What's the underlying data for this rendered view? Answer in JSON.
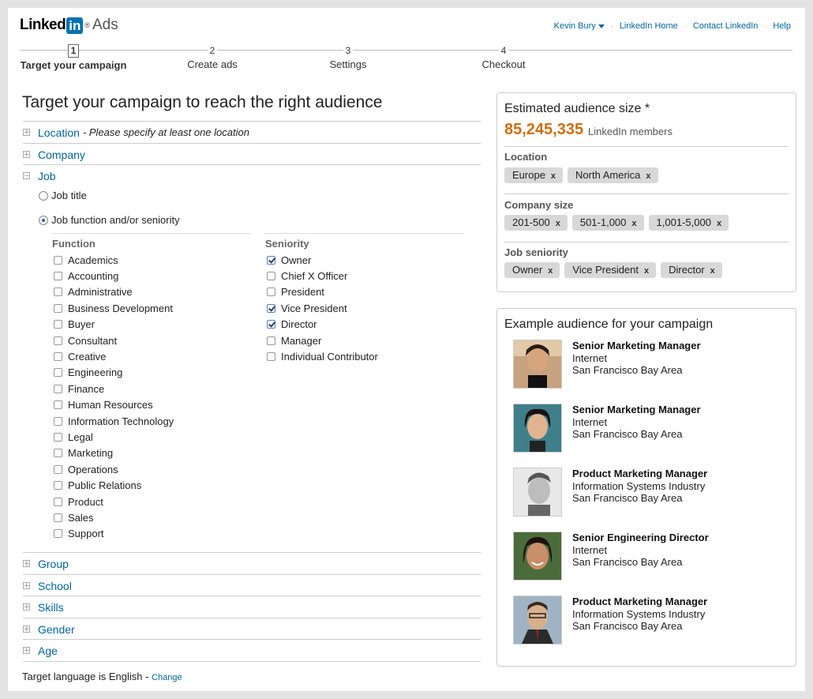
{
  "header": {
    "logo_linked": "Linked",
    "logo_in": "in",
    "logo_reg": "®",
    "logo_ads": "Ads",
    "links": [
      {
        "label": "Kevin Bury",
        "dropdown": true
      },
      {
        "label": "LinkedIn Home"
      },
      {
        "label": "Contact LinkedIn"
      },
      {
        "label": "Help"
      }
    ],
    "separator": "·"
  },
  "steps": [
    {
      "num": "1",
      "label": "Target your campaign",
      "active": true
    },
    {
      "num": "2",
      "label": "Create ads",
      "active": false
    },
    {
      "num": "3",
      "label": "Settings",
      "active": false
    },
    {
      "num": "4",
      "label": "Checkout",
      "active": false
    }
  ],
  "targeting": {
    "title": "Target your campaign to reach the right audience",
    "location": {
      "label": "Location",
      "note": "- Please specify at least one location"
    },
    "company": {
      "label": "Company"
    },
    "job": {
      "label": "Job",
      "radio_title": "Job title",
      "radio_function": "Job function and/or seniority",
      "selected": "function"
    },
    "function_header": "Function",
    "functions": [
      {
        "label": "Academics",
        "checked": false
      },
      {
        "label": "Accounting",
        "checked": false
      },
      {
        "label": "Administrative",
        "checked": false
      },
      {
        "label": "Business Development",
        "checked": false
      },
      {
        "label": "Buyer",
        "checked": false
      },
      {
        "label": "Consultant",
        "checked": false
      },
      {
        "label": "Creative",
        "checked": false
      },
      {
        "label": "Engineering",
        "checked": false
      },
      {
        "label": "Finance",
        "checked": false
      },
      {
        "label": "Human Resources",
        "checked": false
      },
      {
        "label": "Information Technology",
        "checked": false
      },
      {
        "label": "Legal",
        "checked": false
      },
      {
        "label": "Marketing",
        "checked": false
      },
      {
        "label": "Operations",
        "checked": false
      },
      {
        "label": "Public Relations",
        "checked": false
      },
      {
        "label": "Product",
        "checked": false
      },
      {
        "label": "Sales",
        "checked": false
      },
      {
        "label": "Support",
        "checked": false
      }
    ],
    "seniority_header": "Seniority",
    "seniority": [
      {
        "label": "Owner",
        "checked": true
      },
      {
        "label": "Chief X Officer",
        "checked": false
      },
      {
        "label": "President",
        "checked": false
      },
      {
        "label": "Vice President",
        "checked": true
      },
      {
        "label": "Director",
        "checked": true
      },
      {
        "label": "Manager",
        "checked": false
      },
      {
        "label": "Individual Contributor",
        "checked": false
      }
    ],
    "collapsed_sections": [
      "Group",
      "School",
      "Skills",
      "Gender",
      "Age"
    ],
    "expand_symbol": "+",
    "collapse_symbol": "−",
    "language_text": "Target language is English - ",
    "language_change": "Change"
  },
  "audience": {
    "title": "Estimated audience size *",
    "count": "85,245,335",
    "unit": "LinkedIn members",
    "remove_symbol": "x",
    "groups": [
      {
        "label": "Location",
        "tags": [
          "Europe",
          "North America"
        ]
      },
      {
        "label": "Company size",
        "tags": [
          "201-500",
          "501-1,000",
          "1,001-5,000"
        ]
      },
      {
        "label": "Job seniority",
        "tags": [
          "Owner",
          "Vice President",
          "Director"
        ]
      }
    ]
  },
  "examples": {
    "title": "Example audience for your campaign",
    "people": [
      {
        "title": "Senior Marketing Manager",
        "industry": "Internet",
        "location": "San Francisco Bay Area"
      },
      {
        "title": "Senior Marketing Manager",
        "industry": "Internet",
        "location": "San Francisco Bay Area"
      },
      {
        "title": "Product Marketing Manager",
        "industry": "Information Systems Industry",
        "location": "San Francisco Bay Area"
      },
      {
        "title": "Senior Engineering Director",
        "industry": "Internet",
        "location": "San Francisco Bay Area"
      },
      {
        "title": "Product Marketing Manager",
        "industry": "Information Systems Industry",
        "location": "San Francisco Bay Area"
      }
    ]
  },
  "colors": {
    "link": "#006699",
    "audience_count": "#d06d0f",
    "tag_bg": "#d8d8d8"
  }
}
